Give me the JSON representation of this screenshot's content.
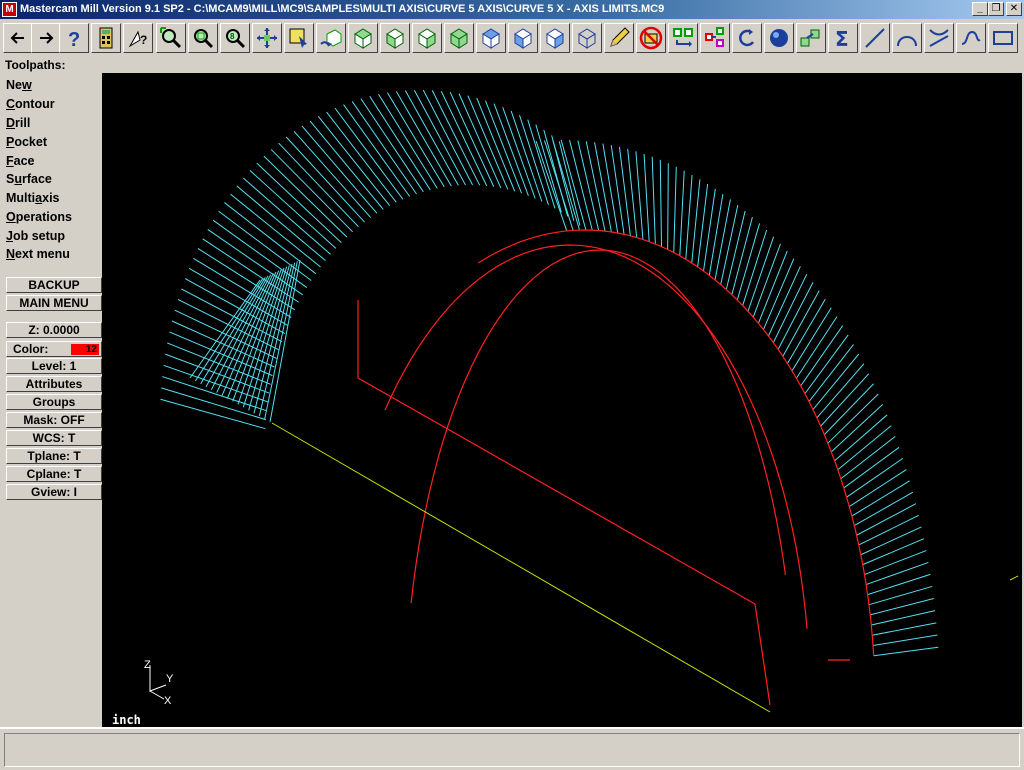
{
  "window": {
    "title": "Mastercam Mill Version 9.1 SP2 - C:\\MCAM9\\MILL\\MC9\\SAMPLES\\MULTI AXIS\\CURVE 5 AXIS\\CURVE 5 X - AXIS LIMITS.MC9",
    "app_icon_text": "M",
    "controls": {
      "minimize": "_",
      "restore": "❐",
      "close": "✕"
    }
  },
  "toolbar": {
    "buttons": [
      {
        "name": "back-arrow",
        "glyph": "←"
      },
      {
        "name": "forward-arrow",
        "glyph": "→"
      },
      {
        "name": "help",
        "glyph": "?"
      },
      {
        "name": "calculator"
      },
      {
        "name": "analyze-query"
      },
      {
        "name": "zoom-window"
      },
      {
        "name": "zoom-fit"
      },
      {
        "name": "zoom-auto"
      },
      {
        "name": "pan"
      },
      {
        "name": "select-screen"
      },
      {
        "name": "dynamic-rotate"
      },
      {
        "name": "view-top"
      },
      {
        "name": "view-front"
      },
      {
        "name": "view-side"
      },
      {
        "name": "view-iso"
      },
      {
        "name": "view-shaded"
      },
      {
        "name": "view-cube-front"
      },
      {
        "name": "view-cube-side"
      },
      {
        "name": "view-cube-back"
      },
      {
        "name": "pencil-edit"
      },
      {
        "name": "no-blank"
      },
      {
        "name": "transform-translate"
      },
      {
        "name": "transform-multi"
      },
      {
        "name": "undo-rotate"
      },
      {
        "name": "sphere-shade"
      },
      {
        "name": "level-manager"
      },
      {
        "name": "sigma-summary",
        "glyph": "Σ"
      },
      {
        "name": "line-draw"
      },
      {
        "name": "arc-draw"
      },
      {
        "name": "trim-break"
      },
      {
        "name": "spline-draw"
      },
      {
        "name": "rectangle-draw"
      }
    ],
    "accent": "#1c3f9c"
  },
  "prompt": {
    "label": "Toolpaths:"
  },
  "menu": {
    "items": [
      {
        "label": "New",
        "mnemonic": "w"
      },
      {
        "label": "Contour",
        "mnemonic": "C"
      },
      {
        "label": "Drill",
        "mnemonic": "D"
      },
      {
        "label": "Pocket",
        "mnemonic": "P"
      },
      {
        "label": "Face",
        "mnemonic": "F"
      },
      {
        "label": "Surface",
        "mnemonic": "u"
      },
      {
        "label": "Multiaxis",
        "mnemonic": "a"
      },
      {
        "label": "Operations",
        "mnemonic": "O"
      },
      {
        "label": "Job setup",
        "mnemonic": "J"
      },
      {
        "label": "Next menu",
        "mnemonic": "N"
      }
    ],
    "backup": "BACKUP",
    "main_menu": "MAIN MENU",
    "status": {
      "z": "Z:  0.0000",
      "color_label": "Color:",
      "color_value": "12",
      "color_hex": "#ff0000",
      "level": "Level:  1",
      "attributes": "Attributes",
      "groups": "Groups",
      "mask": "Mask:  OFF",
      "wcs": "WCS:   T",
      "tplane": "Tplane:  T",
      "cplane": "Cplane:  T",
      "gview": "Gview:   I"
    }
  },
  "viewport": {
    "background": "#000000",
    "toolpath_color": "#55e0f0",
    "geometry_color": "#ff2020",
    "axis_color": "#c8e000",
    "triad": {
      "z": "Z",
      "y": "Y",
      "x": "X"
    },
    "units": "inch"
  }
}
